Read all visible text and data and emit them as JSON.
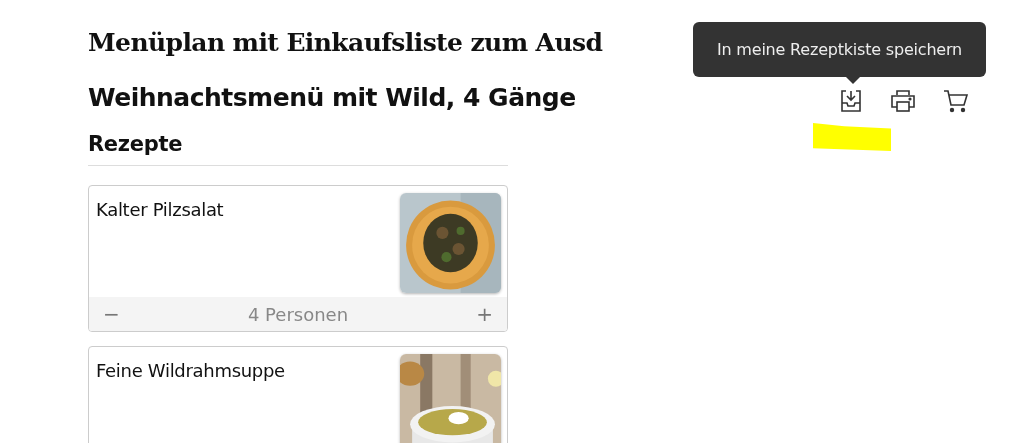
{
  "page_title": "Menüplan mit Einkaufsliste zum Ausd",
  "menu_title": "Weihnachtsmenü mit Wild, 4 Gänge",
  "actions": [
    {
      "kind": "save",
      "tooltip": "In meine Rezeptkiste speichern"
    },
    {
      "kind": "print"
    },
    {
      "kind": "cart"
    }
  ],
  "highlight_mark": {
    "color": "#ffff00"
  },
  "section_title": "Rezepte",
  "recipes": [
    {
      "title": "Kalter Pilzsalat",
      "servings": {
        "minus": "−",
        "label": "4 Personen",
        "plus": "+"
      }
    },
    {
      "title": "Feine Wildrahmsuppe"
    }
  ]
}
